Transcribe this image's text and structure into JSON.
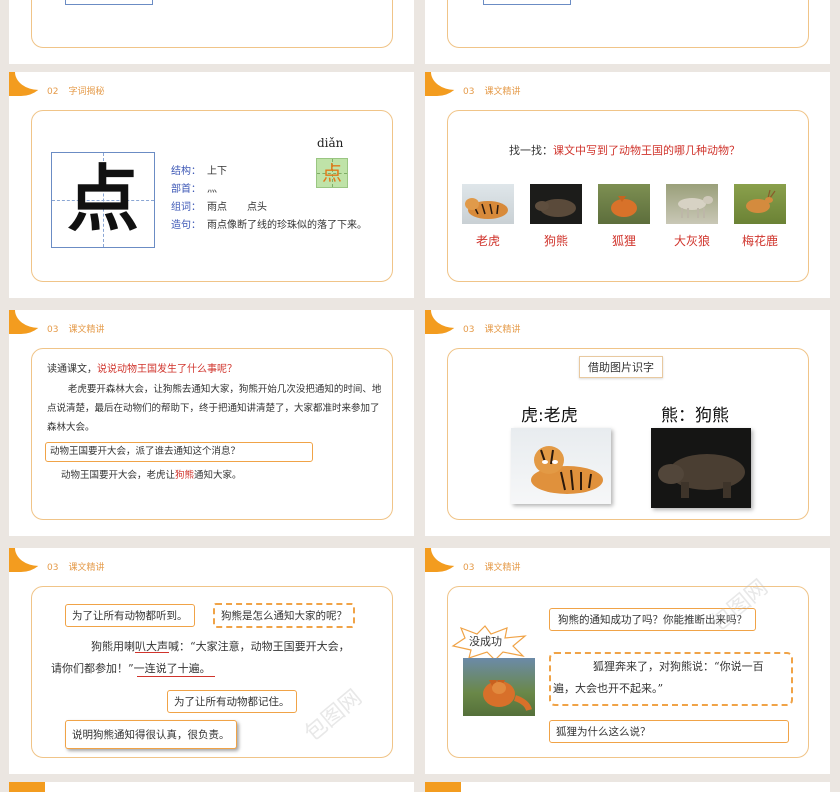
{
  "s2": {
    "sec_num": "02",
    "sec_title": "字词揭秘",
    "char": "点",
    "pinyin": "diǎn",
    "char_small": "点",
    "rows": [
      {
        "k": "结构：",
        "v": "上下"
      },
      {
        "k": "部首：",
        "v": "灬"
      },
      {
        "k": "组词：",
        "v": "雨点　　点头"
      },
      {
        "k": "造句：",
        "v": "雨点像断了线的珍珠似的落了下来。"
      }
    ]
  },
  "s3": {
    "sec_num": "03",
    "sec_title": "课文精讲",
    "q_prefix": "找一找：",
    "q_red": "课文中写到了动物王国的哪几种动物？",
    "animals": [
      "老虎",
      "狗熊",
      "狐狸",
      "大灰狼",
      "梅花鹿"
    ]
  },
  "s4": {
    "sec_num": "03",
    "sec_title": "课文精讲",
    "q_prefix": "读通课文，",
    "q_red": "说说动物王国发生了什么事呢？",
    "para": "老虎要开森林大会，让狗熊去通知大家，狗熊开始几次没把通知的时间、地点说清楚，最后在动物们的帮助下，终于把通知讲清楚了，大家都准时来参加了森林大会。",
    "box_q": "动物王国要开大会，派了谁去通知这个消息？",
    "ans_pre": "动物王国要开大会，老虎让",
    "ans_red": "狗熊",
    "ans_post": "通知大家。"
  },
  "s5": {
    "sec_num": "03",
    "sec_title": "课文精讲",
    "banner": "借助图片识字",
    "tiger_label": "虎:老虎",
    "bear_label": "熊：狗熊"
  },
  "s6": {
    "sec_num": "03",
    "sec_title": "课文精讲",
    "b1": "为了让所有动物都听到。",
    "b2": "狗熊是怎么通知大家的呢？",
    "para1": "狗熊用喇叭大声喊：“大家注意，动物王国要开大会，",
    "para2": "请你们都参加！”一连说了十遍。",
    "b3": "为了让所有动物都记住。",
    "b4": "说明狗熊通知得很认真，很负责。"
  },
  "s7": {
    "sec_num": "03",
    "sec_title": "课文精讲",
    "q1": "狗熊的通知成功了吗？你能推断出来吗？",
    "burst": "没成功",
    "quote1": "狐狸奔来了，对狗熊说：“你说一百",
    "quote2": "遍，大会也开不起来。”",
    "q2": "狐狸为什么这么说？"
  },
  "watermark": "包图网"
}
